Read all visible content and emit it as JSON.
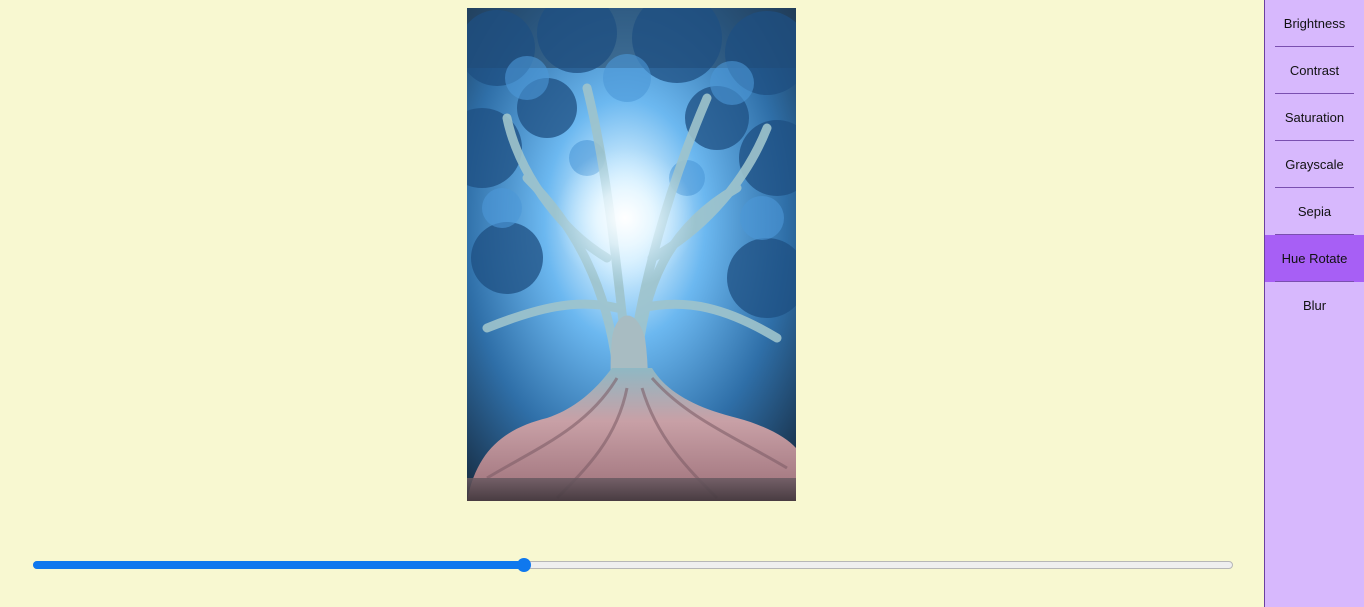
{
  "filters": {
    "items": [
      {
        "label": "Brightness",
        "active": false
      },
      {
        "label": "Contrast",
        "active": false
      },
      {
        "label": "Saturation",
        "active": false
      },
      {
        "label": "Grayscale",
        "active": false
      },
      {
        "label": "Sepia",
        "active": false
      },
      {
        "label": "Hue Rotate",
        "active": true
      },
      {
        "label": "Blur",
        "active": false
      }
    ]
  },
  "slider": {
    "value_fraction": 0.409,
    "fill_color": "#0f78ee",
    "track_color": "#efefef"
  },
  "colors": {
    "page_background": "#f8f8d1",
    "sidebar_background": "#d7b8fd",
    "active_item": "#a75ff5"
  },
  "image": {
    "subject": "tree-with-sunburst"
  }
}
